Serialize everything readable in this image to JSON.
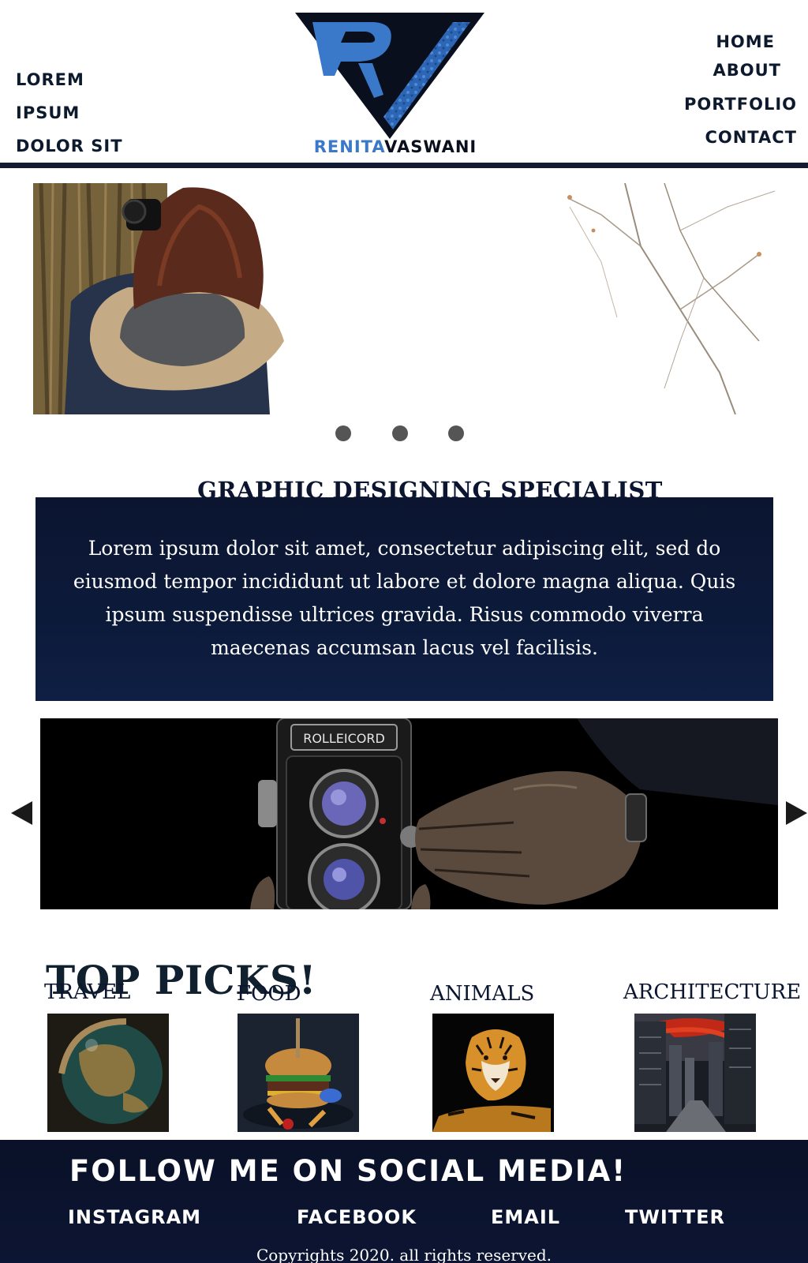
{
  "header": {
    "left_nav": [
      "LOREM",
      "IPSUM",
      "DOLOR SIT"
    ],
    "right_nav": [
      "HOME",
      "ABOUT",
      "PORTFOLIO",
      "CONTACT"
    ],
    "logo": {
      "first_name": "RENITA",
      "last_name": "VASWANI",
      "mark": "v-logo-icon",
      "colors": {
        "accent_blue": "#3a79c9",
        "dark": "#0a0f1e"
      }
    }
  },
  "hero": {
    "image": "photographer-in-fur-hood-photo",
    "dots": 3
  },
  "specialist": {
    "title": "GRAPHIC DESIGNING SPECIALIST",
    "body": "Lorem ipsum dolor sit amet, consectetur adipiscing elit, sed do eiusmod tempor incididunt ut labore et dolore magna aliqua. Quis ipsum suspendisse ultrices gravida. Risus commodo viverra maecenas accumsan lacus vel facilisis."
  },
  "slider": {
    "image": "rolleicord-camera-photo",
    "camera_brand": "ROLLEICORD",
    "prev_icon": "triangle-left-icon",
    "next_icon": "triangle-right-icon"
  },
  "top_picks": {
    "title": "TOP PICKS!",
    "items": [
      {
        "label": "TRAVEL",
        "image": "globe-photo"
      },
      {
        "label": "FOOD",
        "image": "burger-photo"
      },
      {
        "label": "ANIMALS",
        "image": "tiger-photo"
      },
      {
        "label": "ARCHITECTURE",
        "image": "city-street-photo"
      }
    ]
  },
  "footer": {
    "title": "FOLLOW ME  ON SOCIAL MEDIA!",
    "links": [
      "INSTAGRAM",
      "FACEBOOK",
      "EMAIL",
      "TWITTER"
    ],
    "copyright": "Copyrights 2020. all rights reserved."
  },
  "colors": {
    "navy": "#0b1530",
    "footer_bg": "#0a1128",
    "dot": "#555555"
  }
}
